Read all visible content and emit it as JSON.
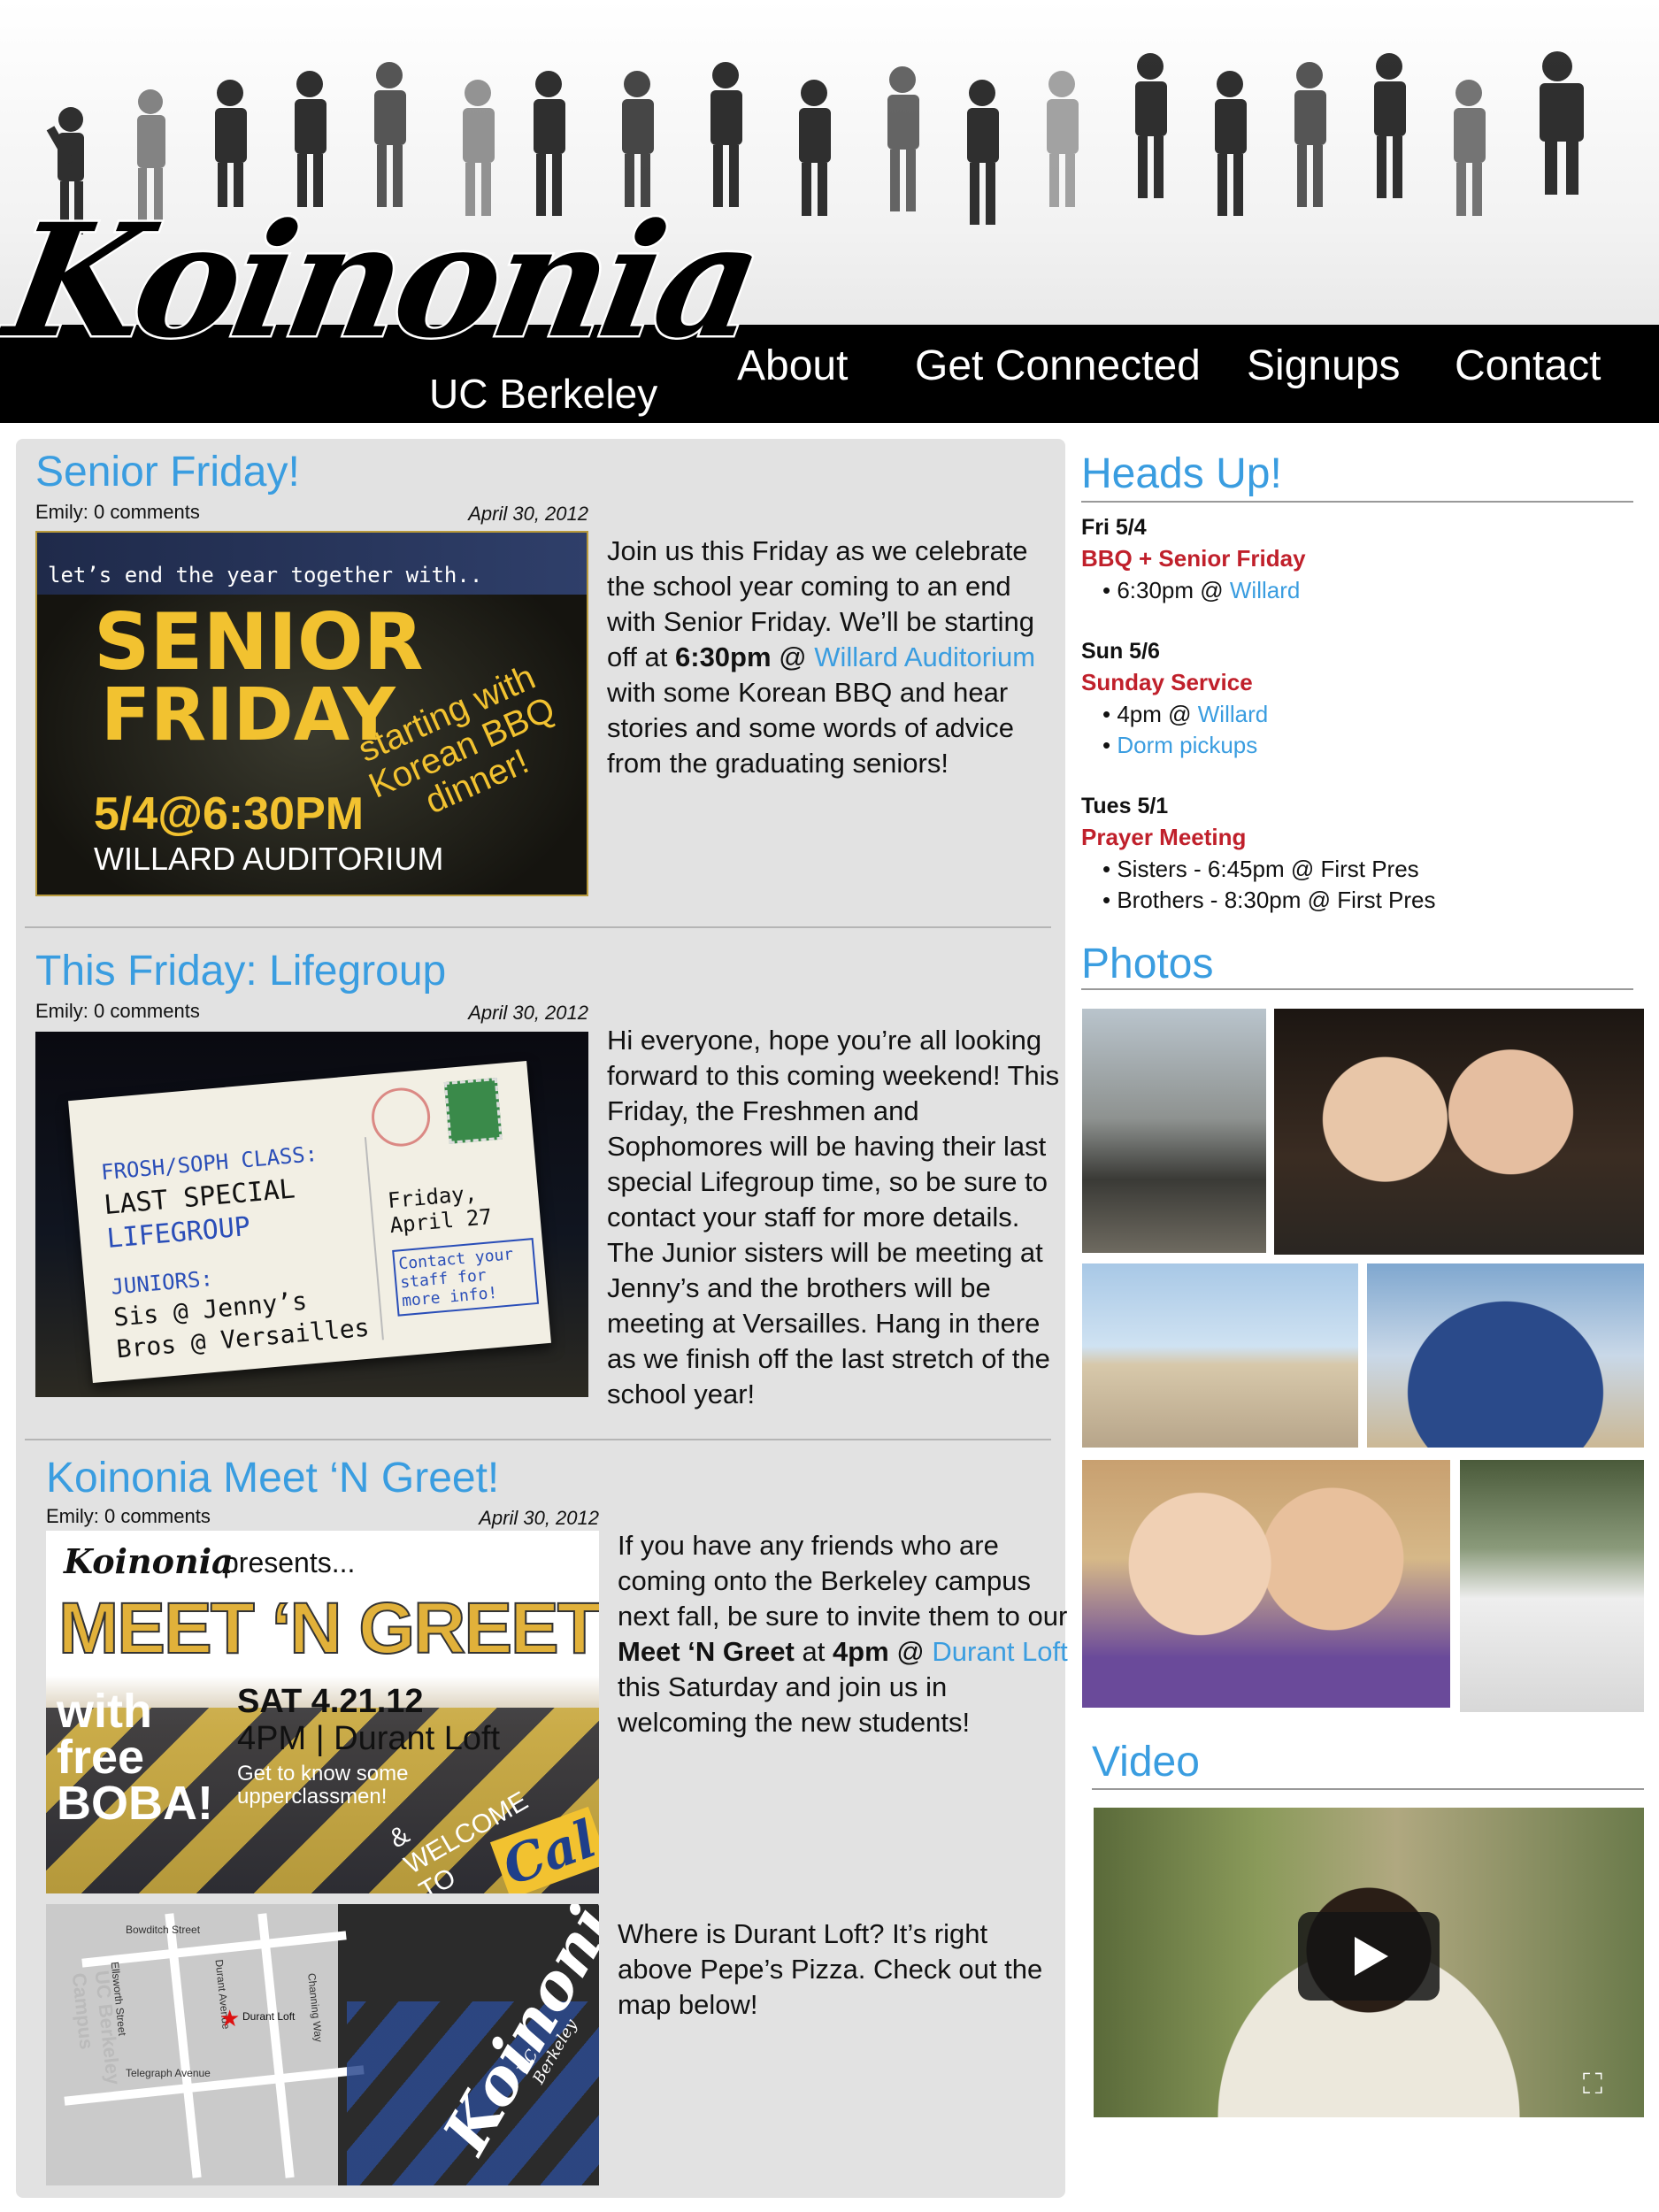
{
  "site": {
    "logo_text": "Koinonia",
    "logo_subtitle": "UC Berkeley"
  },
  "nav": [
    {
      "label": "About"
    },
    {
      "label": "Get Connected"
    },
    {
      "label": "Signups"
    },
    {
      "label": "Contact"
    }
  ],
  "posts": [
    {
      "title": "Senior Friday!",
      "meta": "Emily: 0 comments",
      "date": "April 30, 2012",
      "text_1": "Join us this Friday as we celebrate the school year coming to an end with Senior Friday. We’ll be starting off at ",
      "bold_1": "6:30pm",
      "text_2": " @ ",
      "link_1": "Willard Auditorium",
      "text_3": " with some Korean BBQ and hear stories and some words of advice from the graduating seniors!",
      "flyer": {
        "top_line": "let’s end the year together with..",
        "headline_1": "SENIOR",
        "headline_2": "FRIDAY",
        "tagline": "starting with Korean BBQ dinner!",
        "when": "5/4@6:30PM",
        "where": "WILLARD AUDITORIUM"
      }
    },
    {
      "title": "This Friday: Lifegroup",
      "meta": "Emily: 0 comments",
      "date": "April 30, 2012",
      "text": "Hi everyone, hope you’re all looking forward to this coming weekend! This Friday, the Freshmen and Sophomores will be having their last special Lifegroup time, so be sure to contact your staff for more details. The Junior sisters will be meeting at Jenny’s and the brothers will be meeting at Versailles. Hang in there as we finish off the last stretch of the school year!",
      "flyer": {
        "line_1": "FROSH/SOPH CLASS:",
        "line_2": "LAST SPECIAL",
        "line_3": "LIFEGROUP",
        "line_4": "JUNIORS:",
        "line_5": "Sis @ Jenny’s",
        "line_6": "Bros @ Versailles",
        "date": "Friday, April 27",
        "note": "Contact your staff for more info!"
      }
    },
    {
      "title": "Koinonia Meet ‘N Greet!",
      "meta": "Emily: 0 comments",
      "date": "April 30, 2012",
      "text_1": "If you have any friends who are coming onto the Berkeley campus next fall, be sure to invite them to our ",
      "bold_1": "Meet ‘N Greet",
      "text_2": " at ",
      "bold_2": "4pm",
      "text_3": " @ ",
      "link_1": "Durant Loft",
      "text_4": " this Saturday and join us in welcoming the new students!",
      "text_b": "Where is Durant Loft? It’s right above Pepe’s Pizza. Check out the map below!",
      "flyer": {
        "brand": "Koinonia",
        "presents": "presents...",
        "headline": "MEET ‘N GREET",
        "with": "with free BOBA!",
        "date": "SAT 4.21.12",
        "time": "4PM | Durant Loft",
        "tagline": "Get to know some upperclassmen!",
        "welcome": "& WELCOME TO",
        "cal": "Cal"
      },
      "map": {
        "streets": [
          "Bowditch Street",
          "Durant Avenue",
          "Channing Way",
          "Telegraph Avenue",
          "Ellsworth Street"
        ],
        "marker": "Durant Loft",
        "campus": "UC Berkeley Campus",
        "brand": "Koinonia",
        "brand_sub": "UC Berkeley"
      }
    }
  ],
  "sidebar": {
    "heads_up_title": "Heads Up!",
    "events": [
      {
        "date": "Fri 5/4",
        "name": "BBQ + Senior Friday",
        "details": [
          {
            "text": "• 6:30pm @ ",
            "link": "Willard"
          }
        ]
      },
      {
        "date": "Sun 5/6",
        "name": "Sunday Service",
        "details": [
          {
            "text": "• 4pm @ ",
            "link": "Willard"
          },
          {
            "text": "• ",
            "link": "Dorm pickups"
          }
        ]
      },
      {
        "date": "Tues 5/1",
        "name": "Prayer Meeting",
        "details": [
          {
            "text": "• Sisters - 6:45pm @ First Pres",
            "link": ""
          },
          {
            "text": "• Brothers - 8:30pm @ First Pres",
            "link": ""
          }
        ]
      }
    ],
    "photos_title": "Photos",
    "video_title": "Video"
  },
  "colors": {
    "link_blue": "#3a9de0",
    "event_red": "#c0202b",
    "panel_gray": "#e2e2e2",
    "nav_black": "#000000"
  }
}
